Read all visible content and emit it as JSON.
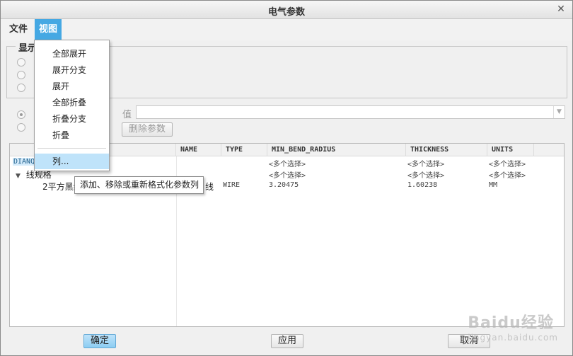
{
  "window": {
    "title": "电气参数",
    "close_glyph": "✕"
  },
  "menubar": {
    "file": "文件",
    "view": "视图"
  },
  "display_group": {
    "title": "显示"
  },
  "param_row": {
    "value_label": "值",
    "delete_button": "删除参数"
  },
  "tree": {
    "columns": [
      "NAME",
      "TYPE",
      "MIN_BEND_RADIUS",
      "THICKNESS",
      "UNITS"
    ],
    "rows": [
      {
        "name": "DIANQ",
        "cells": [
          "",
          "",
          "<多个选择>",
          "<多个选择>",
          "<多个选择>"
        ]
      },
      {
        "name": "线规格",
        "expander": "▼",
        "cells": [
          "",
          "",
          "<多个选择>",
          "<多个选择>",
          "<多个选择>"
        ]
      },
      {
        "name": "2平方黑线",
        "name_tail": "线",
        "cells": [
          "",
          "WIRE",
          "3.20475",
          "1.60238",
          "MM"
        ]
      }
    ]
  },
  "dropdown_menu": {
    "items": [
      "全部展开",
      "展开分支",
      "展开",
      "全部折叠",
      "折叠分支",
      "折叠"
    ],
    "columns_item": "列..."
  },
  "tooltip": {
    "text": "添加、移除或重新格式化参数列"
  },
  "footer": {
    "ok": "确定",
    "apply": "应用",
    "cancel": "取消"
  },
  "watermark": {
    "text": "Baidu经验",
    "url": "jingyan.baidu.com"
  }
}
